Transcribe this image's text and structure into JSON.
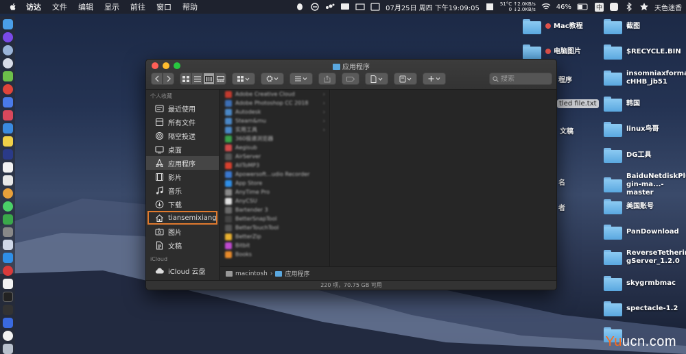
{
  "menubar": {
    "items": [
      "访达",
      "文件",
      "编辑",
      "显示",
      "前往",
      "窗口",
      "帮助"
    ],
    "clock": "07月25日 周四 下午19:09:05",
    "temp": "51°C",
    "net_up": "↑2.0KB/s",
    "net_down_prefix": "0",
    "net_down": "↓2.0KB/s",
    "battery": "46%",
    "ime": "中",
    "user": "天色迷香"
  },
  "desktop": {
    "right_col": [
      {
        "label": "截图"
      },
      {
        "label": "$RECYCLE.BIN"
      },
      {
        "label": "insomniaxformacHHB_jb51",
        "line1": "insomniaxforma",
        "line2": "cHHB_jb51"
      },
      {
        "label": "韩国"
      },
      {
        "label": "linux鸟哥"
      },
      {
        "label": "DG工具"
      },
      {
        "label": "BaiduNetdiskPlugin-ma...-master",
        "line1": "BaiduNetdiskPlu",
        "line2": "gin-ma...-master"
      },
      {
        "label": "美国账号"
      },
      {
        "label": "PanDownload"
      },
      {
        "label": "ReverseTetheringServer_1.2.0",
        "line1": "ReverseTetherin",
        "line2": "gServer_1.2.0"
      },
      {
        "label": "skygrmbmac"
      },
      {
        "label": "spectacle-1.2"
      }
    ],
    "left_col": [
      {
        "label": "Mac教程"
      },
      {
        "label": "电脑图片"
      }
    ],
    "partials": [
      "程序",
      "tled file.txt",
      "文稿",
      "名",
      "者"
    ]
  },
  "finder": {
    "title": "应用程序",
    "search_placeholder": "搜索",
    "sidebar_header_favorites": "个人收藏",
    "favorites": [
      {
        "label": "最近使用",
        "icon": "recents-icon"
      },
      {
        "label": "所有文件",
        "icon": "all-files-icon"
      },
      {
        "label": "隔空投送",
        "icon": "airdrop-icon"
      },
      {
        "label": "桌面",
        "icon": "desktop-icon"
      },
      {
        "label": "应用程序",
        "icon": "applications-icon",
        "selected": true
      },
      {
        "label": "影片",
        "icon": "movies-icon"
      },
      {
        "label": "音乐",
        "icon": "music-icon"
      },
      {
        "label": "下载",
        "icon": "downloads-icon"
      },
      {
        "label": "tiansemixiang",
        "icon": "home-icon",
        "highlighted": true
      },
      {
        "label": "图片",
        "icon": "pictures-icon"
      },
      {
        "label": "文稿",
        "icon": "documents-icon"
      }
    ],
    "sidebar_header_icloud": "iCloud",
    "icloud_item": "iCloud 云盘",
    "apps": [
      {
        "name": "Adobe Creative Cloud",
        "color": "#c23a2e",
        "folder": true
      },
      {
        "name": "Adobe Photoshop CC 2018",
        "color": "#3d6fb5",
        "folder": true
      },
      {
        "name": "Autodesk",
        "color": "#4a88c8",
        "folder": true
      },
      {
        "name": "Steam&mu",
        "color": "#4a88c8",
        "folder": true
      },
      {
        "name": "实用工具",
        "color": "#4a88c8",
        "folder": true
      },
      {
        "name": "360极速浏览器",
        "color": "#3aa24a",
        "folder": false
      },
      {
        "name": "Aegisub",
        "color": "#d24a4a",
        "folder": false
      },
      {
        "name": "AirServer",
        "color": "#555555",
        "folder": false
      },
      {
        "name": "AllToMP3",
        "color": "#d8402e",
        "folder": false
      },
      {
        "name": "Apowersoft...udio Recorder",
        "color": "#3a78d0",
        "folder": false
      },
      {
        "name": "App Store",
        "color": "#2f8fe8",
        "folder": false
      },
      {
        "name": "AnyTime Pro",
        "color": "#8a8a8a",
        "folder": false
      },
      {
        "name": "AnyCSU",
        "color": "#e0e0e0",
        "folder": false
      },
      {
        "name": "Bartender 3",
        "color": "#6a6a6a",
        "folder": false
      },
      {
        "name": "BetterSnapTool",
        "color": "#444444",
        "folder": false
      },
      {
        "name": "BetterTouchTool",
        "color": "#555555",
        "folder": false
      },
      {
        "name": "BetterZip",
        "color": "#e8b030",
        "folder": false
      },
      {
        "name": "Bitbit",
        "color": "#c04ad0",
        "folder": false
      },
      {
        "name": "Books",
        "color": "#e88a2a",
        "folder": false
      }
    ],
    "path": [
      "macintosh",
      "应用程序"
    ],
    "path_sep": "›",
    "status": "220 项，70.75 GB 可用"
  },
  "watermark": {
    "yu": "Yu",
    "rest": "ucn.com"
  }
}
